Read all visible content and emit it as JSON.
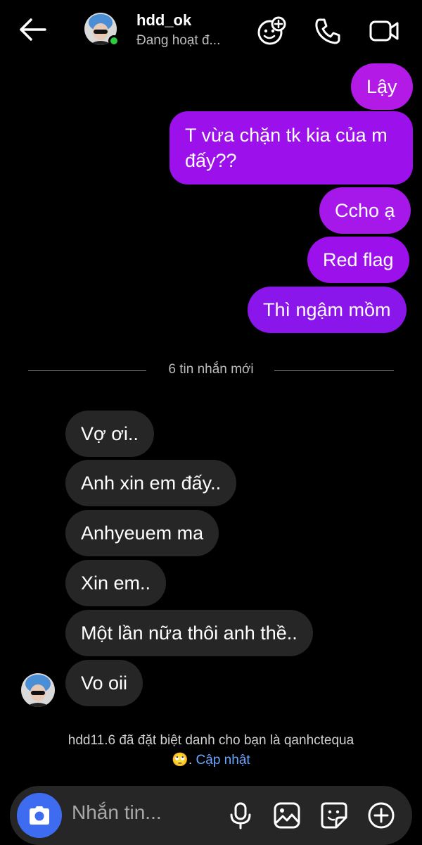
{
  "header": {
    "name": "hdd_ok",
    "status": "Đang hoạt đ..."
  },
  "messages_sent": [
    {
      "text": "Lậy"
    },
    {
      "text": "T vừa chặn tk kia của m đấy??"
    },
    {
      "text": "Ccho ạ"
    },
    {
      "text": "Red flag"
    },
    {
      "text": "Thì ngậm mồm"
    }
  ],
  "divider": "6 tin nhắn mới",
  "messages_received": [
    {
      "text": "Vợ ơi.."
    },
    {
      "text": "Anh xin em đấy.."
    },
    {
      "text": "Anhyeuem ma"
    },
    {
      "text": "Xin em.."
    },
    {
      "text": "Một lần nữa thôi anh thề.."
    },
    {
      "text": "Vo oii"
    }
  ],
  "notice": {
    "text": "hdd11.6 đã đặt biệt danh cho bạn là qanhctequa",
    "emoji": "🙄.",
    "link": "Cập nhật"
  },
  "composer": {
    "placeholder": "Nhắn tin..."
  },
  "colors": {
    "sent_bubble": "#9b10eb",
    "received_bubble": "#262626",
    "camera_button": "#3d6cf0",
    "online": "#2ecb3b",
    "link": "#6aa5ff"
  }
}
